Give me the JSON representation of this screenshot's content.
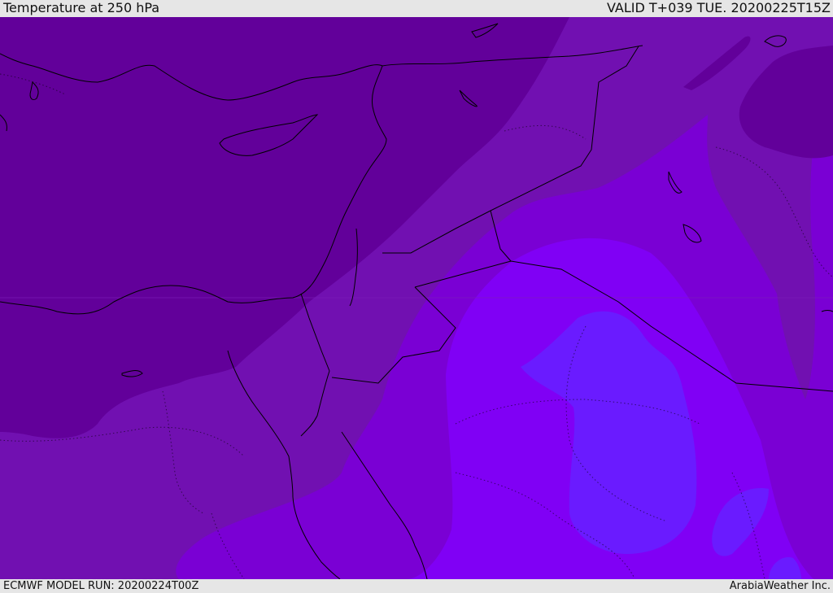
{
  "header": {
    "title": "Temperature at 250 hPa",
    "valid_time": "VALID T+039 TUE. 20200225T15Z"
  },
  "footer": {
    "model_run": "ECMWF MODEL RUN: 20200224T00Z",
    "credit": "ArabiaWeather Inc."
  },
  "map": {
    "variable": "Temperature",
    "level": "250 hPa",
    "colors": {
      "band_coldest": "#62009a",
      "band_2": "#7110b1",
      "band_3": "#7a00d4",
      "band_4": "#8000f5",
      "band_warmest": "#6a1bff",
      "coastline": "#000000",
      "border": "#000000"
    }
  }
}
